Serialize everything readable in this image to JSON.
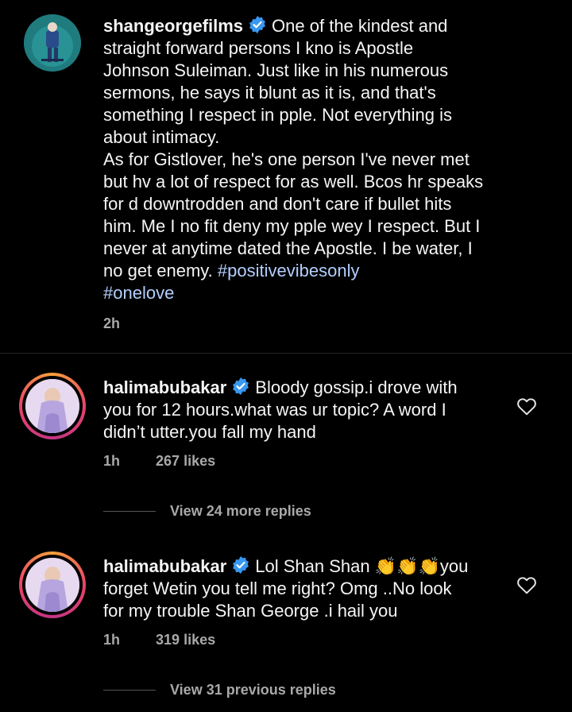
{
  "comments": [
    {
      "username": "shangeorgefilms",
      "text_lines": [
        "One of the kindest and",
        "straight forward persons I kno is Apostle",
        "Johnson Suleiman. Just like in his numerous",
        "sermons, he says it blunt as it is, and that's",
        "something I respect in pple. Not everything is",
        "about intimacy.",
        "As for Gistlover, he's one person I've never met",
        "but hv a lot of respect for as well. Bcos hr speaks",
        "for d downtrodden and don't care if bullet hits",
        "him. Me I no fit deny my pple wey I respect. But I",
        "never at anytime dated  the Apostle. I be water, I",
        "no get enemy. "
      ],
      "hashtag1": "#positivevibesonly",
      "hashtag2": "#onelove",
      "time": "2h"
    },
    {
      "username": "halimabubakar",
      "line1": "Bloody gossip.i drove with",
      "line2": "you for 12 hours.what was ur topic? A word I",
      "line3": "didn’t utter.you fall my hand",
      "time": "1h",
      "likes": "267 likes",
      "view_replies": "View 24 more replies"
    },
    {
      "username": "halimabubakar",
      "line1": "Lol Shan Shan 👏👏👏you",
      "line2": "forget Wetin you tell me right?  Omg ..No look",
      "line3": "for my trouble Shan George .i hail you",
      "time": "1h",
      "likes": "319 likes",
      "view_replies": "View 31 previous replies"
    }
  ],
  "icons": {
    "verified": "verified-badge-icon",
    "like": "heart-outline-icon"
  },
  "colors": {
    "background": "#000000",
    "text": "#f5f5f5",
    "meta": "#a8a8a8",
    "hashtag": "#b3cfff",
    "verified": "#3897f0"
  }
}
